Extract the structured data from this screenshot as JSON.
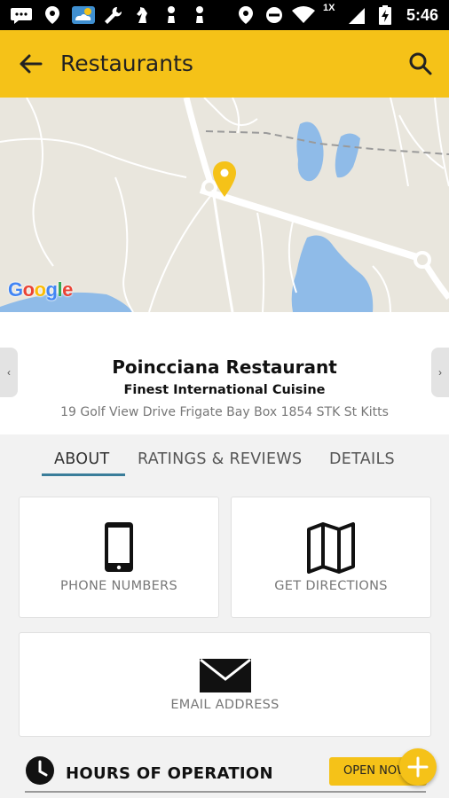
{
  "status_bar": {
    "time": "5:46",
    "network_label": "1X",
    "icons": [
      "message-icon",
      "location-icon",
      "weather-icon",
      "wrench-icon",
      "chess-knight-icon",
      "chess-pawn-icon",
      "chess-pawn-icon",
      "location-icon",
      "do-not-disturb-icon",
      "wifi-icon",
      "signal-icon",
      "battery-charging-icon"
    ]
  },
  "app_bar": {
    "title": "Restaurants",
    "back_icon": "arrow-back-icon",
    "search_icon": "search-icon"
  },
  "map": {
    "attribution": "Google",
    "pin_color": "#f5c218"
  },
  "restaurant": {
    "name": "Poincciana Restaurant",
    "tagline": "Finest International Cuisine",
    "address": "19 Golf View Drive Frigate Bay Box 1854 STK St Kitts",
    "prev_arrow": "‹",
    "next_arrow": "›"
  },
  "tabs": [
    {
      "label": "ABOUT",
      "active": true
    },
    {
      "label": "RATINGS & REVIEWS",
      "active": false
    },
    {
      "label": "DETAILS",
      "active": false
    }
  ],
  "cards": {
    "phone": {
      "label": "PHONE NUMBERS",
      "icon": "smartphone-icon"
    },
    "directions": {
      "label": "GET DIRECTIONS",
      "icon": "map-icon"
    },
    "email": {
      "label": "EMAIL ADDRESS",
      "icon": "envelope-icon"
    }
  },
  "hours": {
    "title": "HOURS OF OPERATION",
    "icon": "clock-icon",
    "status": "OPEN NOW"
  },
  "fab": {
    "icon": "plus-icon"
  },
  "colors": {
    "accent": "#f5c218",
    "tab_underline": "#3a7d9a",
    "map_land": "#e9e6dd",
    "map_water": "#8fbbe8"
  }
}
